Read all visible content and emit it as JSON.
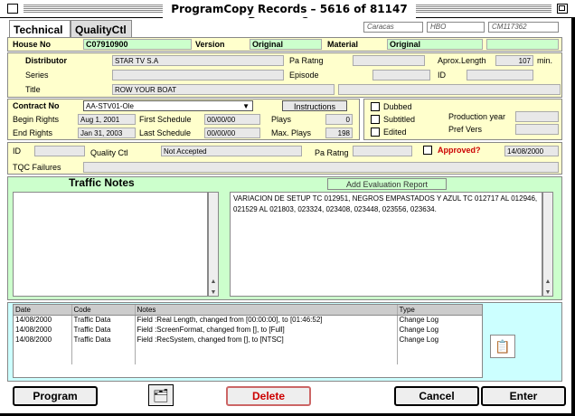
{
  "window": {
    "title": "ProgramCopy Records – 5616 of 81147 ProgramCopy"
  },
  "tabs": [
    {
      "label": "Technical"
    },
    {
      "label": "QualityCtl"
    }
  ],
  "top_info": [
    "Caracas",
    "HBO",
    "CM117362"
  ],
  "header": {
    "house_no_label": "House No",
    "house_no": "C07910900",
    "version_label": "Version",
    "version": "Original",
    "material_label": "Material",
    "material": "Original"
  },
  "program": {
    "distributor_label": "Distributor",
    "distributor": "STAR TV S.A",
    "pa_rating_label": "Pa Ratng",
    "aprox_length_label": "Aprox.Length",
    "aprox_length": "107",
    "min_label": "min.",
    "series_label": "Series",
    "episode_label": "Episode",
    "id_label": "ID",
    "title_label": "Title",
    "title": "ROW YOUR BOAT"
  },
  "contract": {
    "contract_no_label": "Contract No",
    "contract_no": "AA-STV01-Ole",
    "instructions_label": "Instructions",
    "begin_rights_label": "Begin Rights",
    "begin_rights": "Aug 1, 2001",
    "end_rights_label": "End Rights",
    "end_rights": "Jan 31, 2003",
    "first_schedule_label": "First Schedule",
    "first_schedule": "00/00/00",
    "last_schedule_label": "Last Schedule",
    "last_schedule": "00/00/00",
    "plays_label": "Plays",
    "plays": "0",
    "max_plays_label": "Max. Plays",
    "max_plays": "198",
    "dubbed_label": "Dubbed",
    "subtitled_label": "Subtitled",
    "edited_label": "Edited",
    "production_year_label": "Production year",
    "pref_vers_label": "Pref Vers"
  },
  "quality": {
    "id_label": "ID",
    "quality_ctl_label": "Quality Ctl",
    "quality_ctl": "Not Accepted",
    "pa_rating_label": "Pa Ratng",
    "approved_label": "Approved?",
    "approved_date": "14/08/2000",
    "tqc_failures_label": "TQC Failures"
  },
  "traffic": {
    "title": "Traffic Notes",
    "add_eval_label": "Add Evaluation Report",
    "notes_text": "VARIACION DE SETUP TC 012951, NEGROS EMPASTADOS Y AZUL TC 012717 AL 012946, 021529 AL 021803, 023324, 023408, 023448, 023556, 023634."
  },
  "log": {
    "columns": [
      "Date",
      "Code",
      "Notes",
      "Type"
    ],
    "rows": [
      [
        "14/08/2000",
        "Traffic Data",
        "Field :Real Length, changed from [00:00:00], to [01:46:52]",
        "Change Log"
      ],
      [
        "14/08/2000",
        "Traffic Data",
        "Field :ScreenFormat, changed from [], to [Full]",
        "Change Log"
      ],
      [
        "14/08/2000",
        "Traffic Data",
        "Field :RecSystem, changed from [], to [NTSC]",
        "Change Log"
      ]
    ]
  },
  "footer": {
    "program_label": "Program",
    "delete_label": "Delete",
    "cancel_label": "Cancel",
    "enter_label": "Enter"
  },
  "colors": {
    "panel": "#ffffcc",
    "accent_green": "#ccffcc",
    "log_bg": "#ccffff",
    "approved_red": "#cc0000"
  }
}
